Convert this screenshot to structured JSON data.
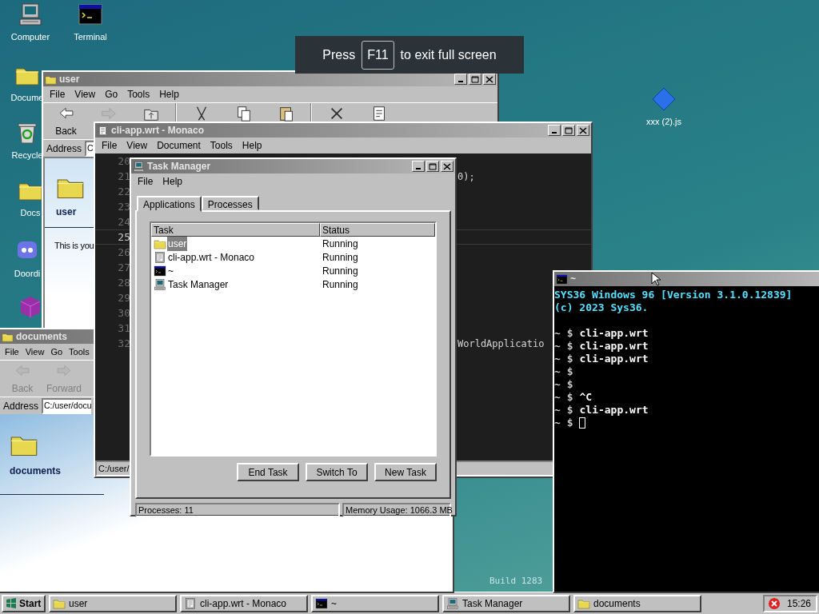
{
  "desktop_icons": [
    {
      "label": "Computer",
      "kind": "computer"
    },
    {
      "label": "Terminal",
      "kind": "terminal"
    },
    {
      "label": "Docume",
      "kind": "folder"
    },
    {
      "label": "Recycle",
      "kind": "recycle"
    },
    {
      "label": "Docs",
      "kind": "folder"
    },
    {
      "label": "Doordi",
      "kind": "chat"
    },
    {
      "kind": "cube"
    },
    {
      "label": "xxx (2).js",
      "kind": "script"
    }
  ],
  "fullscreen_notice": {
    "before": "Press",
    "key": "F11",
    "after": "to exit full screen"
  },
  "desktop_text": "Build 1283",
  "user_window": {
    "title": "user",
    "menu": [
      "File",
      "View",
      "Go",
      "Tools",
      "Help"
    ],
    "toolbar": [
      {
        "label": "Back",
        "kind": "back",
        "disabled": false
      },
      {
        "kind": "forward",
        "disabled": true
      },
      {
        "kind": "up",
        "disabled": false
      },
      {
        "kind": "cut",
        "disabled": false
      },
      {
        "kind": "copy",
        "disabled": false
      },
      {
        "kind": "paste",
        "disabled": false
      },
      {
        "kind": "delete",
        "disabled": false
      },
      {
        "kind": "properties",
        "disabled": false
      }
    ],
    "address_label": "Address",
    "address": "C",
    "folder_label": "user",
    "description": "This is you"
  },
  "documents_window": {
    "title": "documents",
    "menu": [
      "File",
      "View",
      "Go",
      "Tools"
    ],
    "toolbar": [
      {
        "label": "Back",
        "kind": "back",
        "disabled": true
      },
      {
        "label": "Forward",
        "kind": "forward",
        "disabled": true
      }
    ],
    "address_label": "Address",
    "address": "C:/user/docu",
    "folder_label": "documents"
  },
  "editor_window": {
    "title": "cli-app.wrt - Monaco",
    "menu": [
      "File",
      "View",
      "Document",
      "Tools",
      "Help"
    ],
    "lines": [
      {
        "number": "20",
        "current": false
      },
      {
        "number": "21",
        "current": false,
        "code": "0);"
      },
      {
        "number": "22",
        "current": false
      },
      {
        "number": "23",
        "current": false
      },
      {
        "number": "24",
        "current": false
      },
      {
        "number": "25",
        "current": true
      },
      {
        "number": "26",
        "current": false
      },
      {
        "number": "27",
        "current": false
      },
      {
        "number": "28",
        "current": false
      },
      {
        "number": "29",
        "current": false
      },
      {
        "number": "30",
        "current": false
      },
      {
        "number": "31",
        "current": false
      },
      {
        "number": "32",
        "current": false,
        "code": "WorldApplicatio"
      }
    ],
    "status": "C:/user/"
  },
  "task_manager": {
    "title": "Task Manager",
    "menu": [
      "File",
      "Help"
    ],
    "tabs": [
      {
        "label": "Applications",
        "selected": true
      },
      {
        "label": "Processes",
        "selected": false
      }
    ],
    "columns": [
      "Task",
      "Status"
    ],
    "rows": [
      {
        "task": "user",
        "status": "Running",
        "kind": "folder",
        "selected": true
      },
      {
        "task": "cli-app.wrt - Monaco",
        "status": "Running",
        "kind": "editor",
        "selected": false
      },
      {
        "task": "~",
        "status": "Running",
        "kind": "terminal",
        "selected": false
      },
      {
        "task": "Task Manager",
        "status": "Running",
        "kind": "taskmgr",
        "selected": false
      }
    ],
    "buttons": [
      "End Task",
      "Switch To",
      "New Task"
    ],
    "status_bar": [
      "Processes: 11",
      "Memory Usage: 1066.3 MB"
    ]
  },
  "terminal": {
    "title": "~",
    "header": [
      "SYS36 Windows 96 [Version 3.1.0.12839]",
      "(c) 2023 Sys36."
    ],
    "lines": [
      {
        "prompt": "~ $",
        "command": "cli-app.wrt",
        "cursor": false
      },
      {
        "prompt": "~ $",
        "command": "cli-app.wrt",
        "cursor": false
      },
      {
        "prompt": "~ $",
        "command": "cli-app.wrt",
        "cursor": false
      },
      {
        "prompt": "~ $",
        "cursor": false
      },
      {
        "prompt": "~ $",
        "cursor": false
      },
      {
        "prompt": "~ $",
        "command": "^C",
        "cursor": false
      },
      {
        "prompt": "~ $",
        "command": "cli-app.wrt",
        "cursor": false
      },
      {
        "prompt": "~ $",
        "cursor": true
      }
    ]
  },
  "taskbar": {
    "start": "Start",
    "tasks": [
      {
        "label": "user",
        "kind": "folder"
      },
      {
        "label": "cli-app.wrt - Monaco",
        "kind": "editor"
      },
      {
        "label": "~",
        "kind": "terminal"
      },
      {
        "label": "Task Manager",
        "kind": "taskmgr"
      },
      {
        "label": "documents",
        "kind": "folder"
      }
    ],
    "clock": "15:26"
  }
}
